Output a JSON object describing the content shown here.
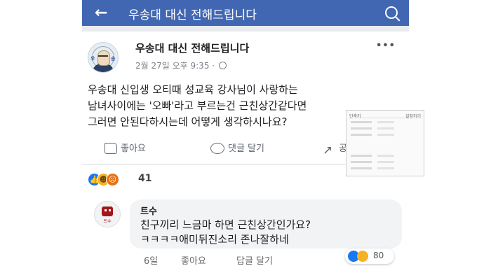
{
  "topbar": {
    "back_icon": "back-arrow-icon",
    "title": "우송대 대신 전해드립니다",
    "search_icon": "search-icon",
    "color": "#4267b2"
  },
  "post": {
    "author": "우송대 대신 전해드립니다",
    "time": "2월 27일 오후 9:35",
    "more": "•••",
    "text": "우송대 신입생 오티때 성교육 강사님이 사랑하는\n남녀사이에는 '오빠'라고 부르는건 근친상간같다면\n그러면 안된다하시는데 어떻게 생각하시나요?",
    "actions": {
      "like": "좋아요",
      "comment": "댓글 달기",
      "share": "공유하기"
    },
    "reaction_count": "41"
  },
  "comment": {
    "author": "트수",
    "avatar_label": "트수",
    "text": "친구끼리 느금마 하면 근친상간인가요?\nㅋㅋㅋㅋ애미뒤진소리 존나잘하네",
    "time": "6일",
    "like": "좋아요",
    "reply": "답글 달기",
    "reaction_count": "80"
  },
  "popup": {
    "header_left": "단축키",
    "header_right": "설정하기"
  }
}
